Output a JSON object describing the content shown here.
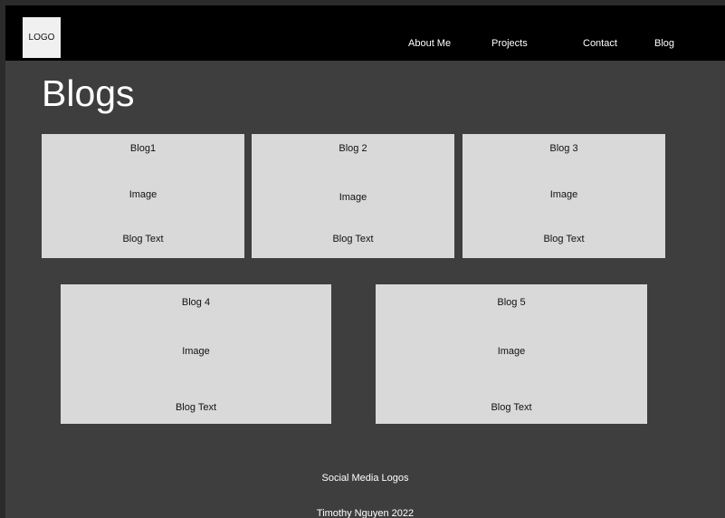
{
  "header": {
    "logo_text": "LOGO",
    "nav": [
      {
        "label": "About Me"
      },
      {
        "label": "Projects"
      },
      {
        "label": "Contact"
      },
      {
        "label": "Blog"
      }
    ]
  },
  "main": {
    "title": "Blogs",
    "cards": [
      {
        "title": "Blog1",
        "image_label": "Image",
        "text_label": "Blog Text"
      },
      {
        "title": "Blog 2",
        "image_label": "Image",
        "text_label": "Blog Text"
      },
      {
        "title": "Blog 3",
        "image_label": "Image",
        "text_label": "Blog Text"
      },
      {
        "title": "Blog 4",
        "image_label": "Image",
        "text_label": "Blog Text"
      },
      {
        "title": "Blog 5",
        "image_label": "Image",
        "text_label": "Blog Text"
      }
    ]
  },
  "footer": {
    "social_label": "Social Media Logos",
    "credit": "Timothy Nguyen 2022"
  },
  "colors": {
    "page_background": "#3e3e3e",
    "header_background": "#000000",
    "card_background": "#d9d9d9",
    "text_light": "#ffffff"
  }
}
